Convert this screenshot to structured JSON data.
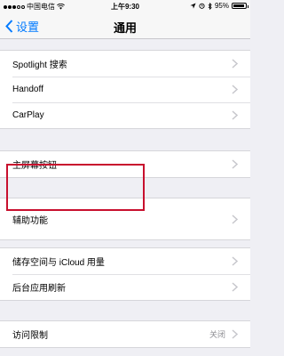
{
  "status_bar": {
    "carrier": "中国电信",
    "time": "上午9:30",
    "battery_percent": "95%",
    "battery_level": 0.95
  },
  "nav": {
    "back_label": "设置",
    "title": "通用"
  },
  "groups": [
    {
      "items": [
        {
          "label": "Spotlight 搜索"
        },
        {
          "label": "Handoff"
        },
        {
          "label": "CarPlay"
        }
      ]
    },
    {
      "items": [
        {
          "label": "主屏幕按钮"
        }
      ]
    },
    {
      "items": [
        {
          "label": "辅助功能"
        }
      ]
    },
    {
      "items": [
        {
          "label": "储存空间与 iCloud 用量"
        },
        {
          "label": "后台应用刷新"
        }
      ]
    },
    {
      "items": [
        {
          "label": "访问限制",
          "value": "关闭"
        }
      ]
    }
  ],
  "colors": {
    "accent": "#007aff",
    "highlight": "#c8102e",
    "background": "#efeff4"
  }
}
